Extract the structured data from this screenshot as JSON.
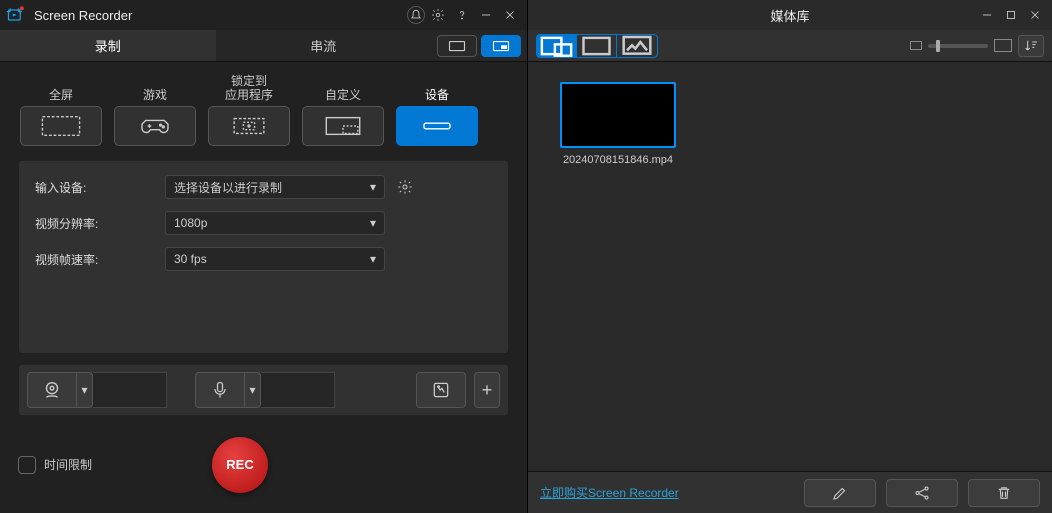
{
  "left": {
    "title": "Screen Recorder",
    "tabs": {
      "record": "录制",
      "stream": "串流"
    },
    "modes": {
      "fullscreen": "全屏",
      "game": "游戏",
      "lockapp_l1": "锁定到",
      "lockapp_l2": "应用程序",
      "custom": "自定义",
      "device": "设备"
    },
    "settings": {
      "input_device_label": "输入设备:",
      "input_device_value": "选择设备以进行录制",
      "resolution_label": "视频分辨率:",
      "resolution_value": "1080p",
      "fps_label": "视频帧速率:",
      "fps_value": "30 fps"
    },
    "time_limit_label": "时间限制",
    "rec_label": "REC"
  },
  "right": {
    "title": "媒体库",
    "items": [
      {
        "name": "20240708151846.mp4"
      }
    ],
    "buy_link": "立即购买Screen Recorder"
  }
}
